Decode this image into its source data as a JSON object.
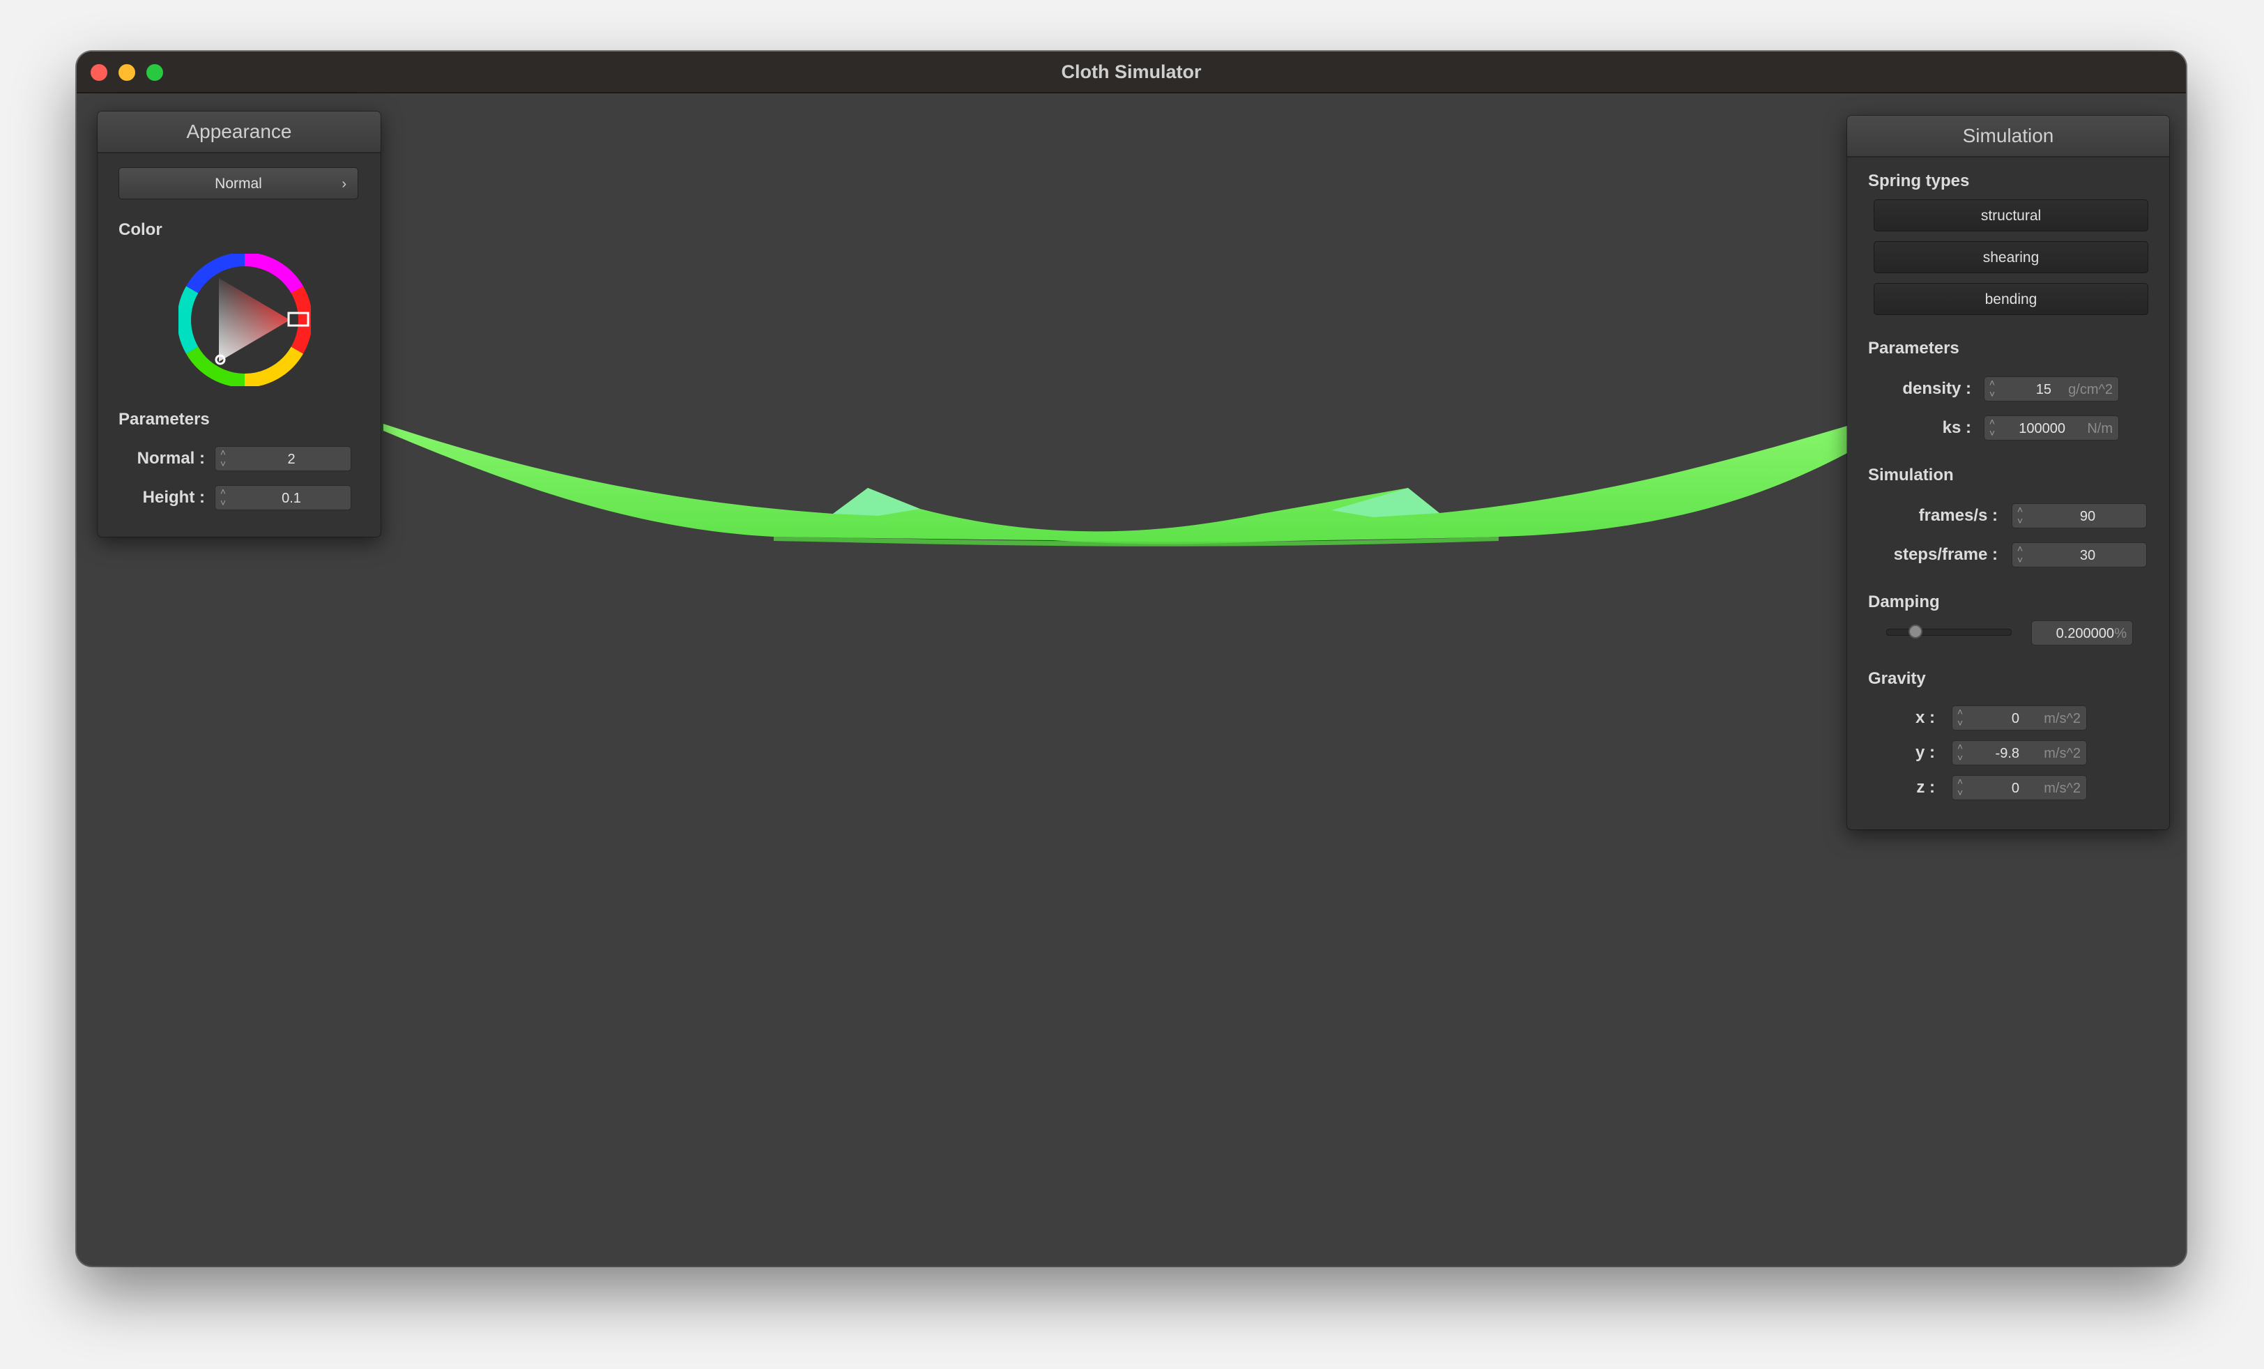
{
  "window": {
    "title": "Cloth Simulator"
  },
  "appearance": {
    "header": "Appearance",
    "shader_select": "Normal",
    "color_label": "Color",
    "parameters_label": "Parameters",
    "normal": {
      "label": "Normal :",
      "value": "2"
    },
    "height": {
      "label": "Height :",
      "value": "0.1"
    }
  },
  "simulation": {
    "header": "Simulation",
    "spring_types_label": "Spring types",
    "springs": [
      "structural",
      "shearing",
      "bending"
    ],
    "parameters_label": "Parameters",
    "density": {
      "label": "density :",
      "value": "15",
      "unit": "g/cm^2"
    },
    "ks": {
      "label": "ks :",
      "value": "100000",
      "unit": "N/m"
    },
    "simulation_label": "Simulation",
    "fps": {
      "label": "frames/s :",
      "value": "90"
    },
    "steps": {
      "label": "steps/frame :",
      "value": "30"
    },
    "damping_label": "Damping",
    "damping": {
      "value": "0.200000",
      "unit": "%",
      "fraction": 0.2
    },
    "gravity_label": "Gravity",
    "gravity": {
      "x": {
        "label": "x :",
        "value": "0",
        "unit": "m/s^2"
      },
      "y": {
        "label": "y :",
        "value": "-9.8",
        "unit": "m/s^2"
      },
      "z": {
        "label": "z :",
        "value": "0",
        "unit": "m/s^2"
      }
    }
  },
  "colors": {
    "cloth": "#6ff25a",
    "cloth_highlight": "#8ef4a2",
    "background": "#3f3f3f"
  }
}
